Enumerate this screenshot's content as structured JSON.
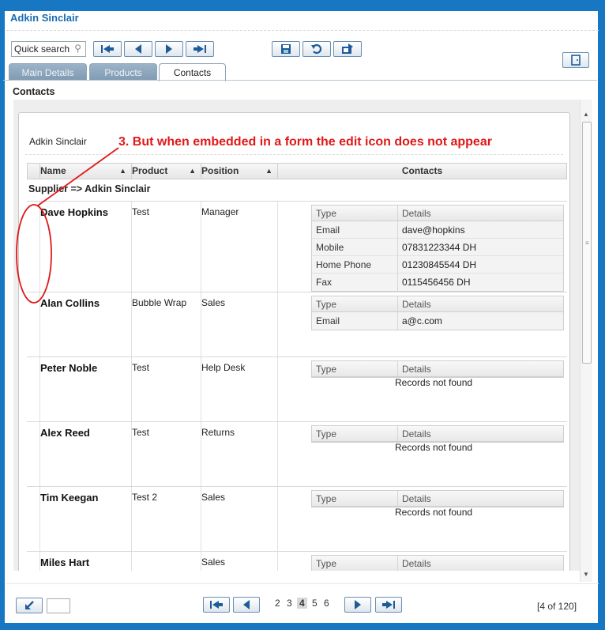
{
  "window": {
    "title": "Adkin Sinclair"
  },
  "toolbar": {
    "quick_search_placeholder": "Quick search",
    "buttons": [
      "first-icon",
      "prev-icon",
      "next-icon",
      "last-icon",
      "save-icon",
      "undo-icon",
      "export-icon",
      "exit-icon"
    ]
  },
  "tabs": [
    {
      "label": "Main Details",
      "active": false
    },
    {
      "label": "Products",
      "active": false
    },
    {
      "label": "Contacts",
      "active": true
    }
  ],
  "section_title": "Contacts",
  "panel": {
    "title": "Adkin Sinclair",
    "annotation": "3. But when embedded in a form the edit icon does not appear"
  },
  "grid": {
    "headers": {
      "name": "Name",
      "product": "Product",
      "position": "Position",
      "contacts": "Contacts"
    },
    "group_label": "Supplier => Adkin Sinclair",
    "sub_headers": {
      "type": "Type",
      "details": "Details"
    },
    "not_found": "Records not found",
    "rows": [
      {
        "name": "Dave Hopkins",
        "product": "Test",
        "position": "Manager",
        "contacts": [
          {
            "type": "Email",
            "details": "dave@hopkins"
          },
          {
            "type": "Mobile",
            "details": "07831223344 DH"
          },
          {
            "type": "Home Phone",
            "details": "01230845544 DH"
          },
          {
            "type": "Fax",
            "details": "0115456456 DH"
          }
        ]
      },
      {
        "name": "Alan Collins",
        "product": "Bubble Wrap",
        "position": "Sales",
        "contacts": [
          {
            "type": "Email",
            "details": "a@c.com"
          }
        ]
      },
      {
        "name": "Peter Noble",
        "product": "Test",
        "position": "Help Desk",
        "contacts": []
      },
      {
        "name": "Alex Reed",
        "product": "Test",
        "position": "Returns",
        "contacts": []
      },
      {
        "name": "Tim Keegan",
        "product": "Test 2",
        "position": "Sales",
        "contacts": []
      },
      {
        "name": "Miles Hart",
        "product": "",
        "position": "Sales",
        "contacts": []
      }
    ]
  },
  "pagination": {
    "pages": [
      "2",
      "3",
      "4",
      "5",
      "6"
    ],
    "current": "4",
    "record_count": "[4 of 120]"
  },
  "colors": {
    "frame": "#1877c3",
    "title": "#1a6bb0",
    "annotation": "#e01818"
  }
}
